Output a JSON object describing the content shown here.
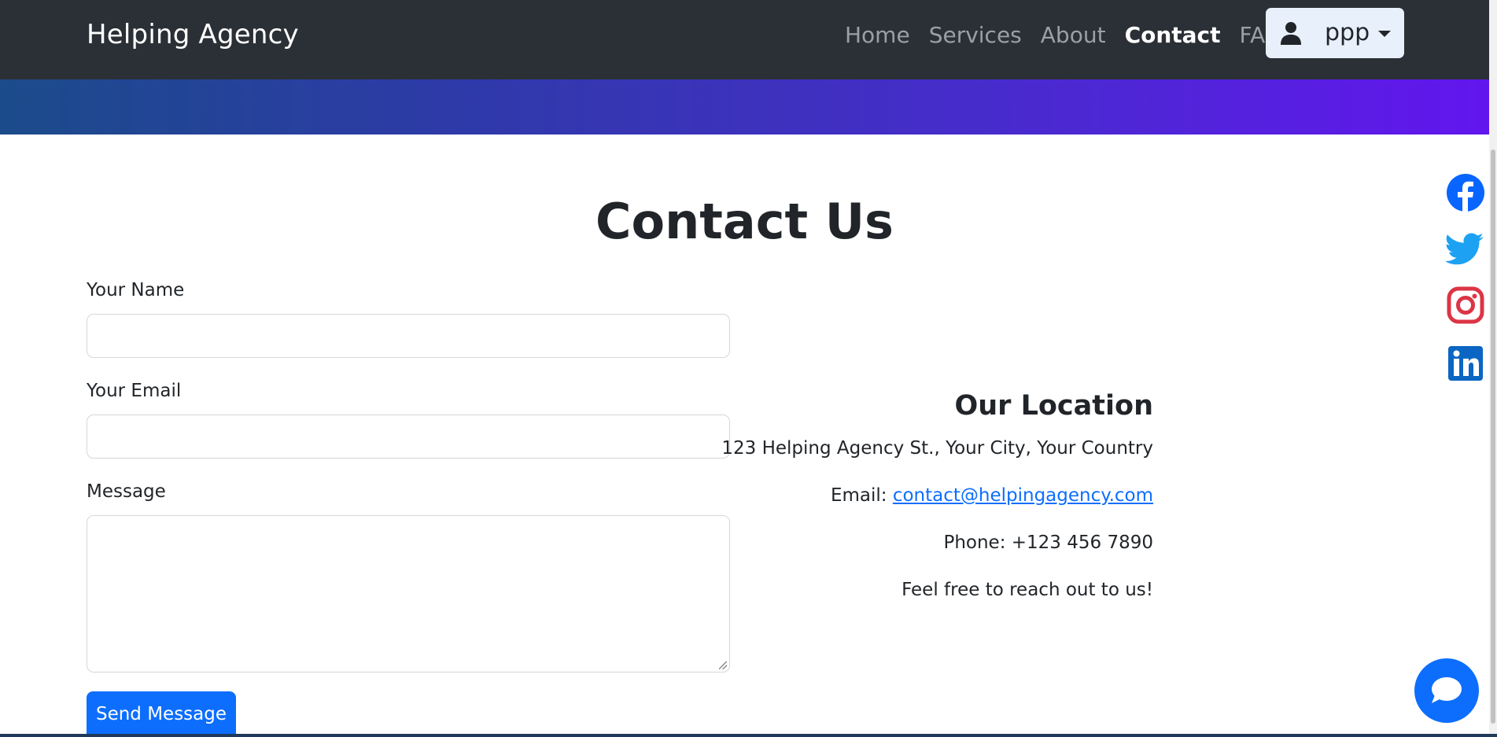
{
  "navbar": {
    "brand": "Helping Agency",
    "links": [
      {
        "label": "Home",
        "active": false
      },
      {
        "label": "Services",
        "active": false
      },
      {
        "label": "About",
        "active": false
      },
      {
        "label": "Contact",
        "active": true
      },
      {
        "label": "FAQs",
        "active": false
      }
    ],
    "user_menu": {
      "label": "ppp",
      "icon": "user-icon"
    }
  },
  "page": {
    "title": "Contact Us"
  },
  "form": {
    "name_label": "Your Name",
    "name_value": "",
    "email_label": "Your Email",
    "email_value": "",
    "message_label": "Message",
    "message_value": "",
    "submit_label": "Send Message"
  },
  "location": {
    "title": "Our Location",
    "address": "123 Helping Agency St., Your City, Your Country",
    "email_prefix": "Email: ",
    "email": "contact@helpingagency.com",
    "phone": "Phone: +123 456 7890",
    "note": "Feel free to reach out to us!"
  },
  "social": [
    {
      "name": "facebook-icon",
      "color": "#0866ff"
    },
    {
      "name": "twitter-icon",
      "color": "#1da1f2"
    },
    {
      "name": "instagram-icon",
      "color": "#dc3545"
    },
    {
      "name": "linkedin-icon",
      "color": "#0a66c2"
    }
  ],
  "colors": {
    "navbar_bg": "#2b3036",
    "primary": "#0d6efd",
    "banner_start": "#1b4b8a",
    "banner_end": "#6216ee"
  },
  "chat": {
    "icon": "chat-bubble-icon"
  }
}
